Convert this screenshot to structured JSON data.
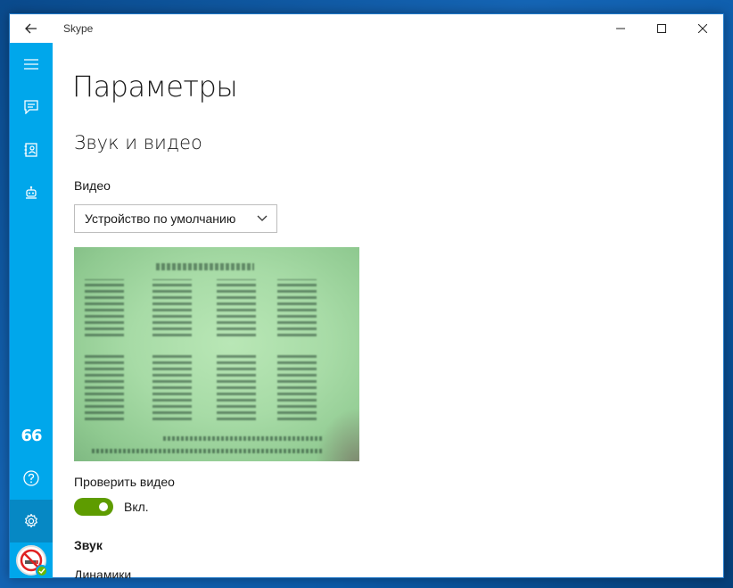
{
  "window": {
    "app_title": "Skype"
  },
  "sidebar": {
    "items": [
      {
        "name": "menu",
        "icon": "hamburger-icon"
      },
      {
        "name": "chats",
        "icon": "chat-icon"
      },
      {
        "name": "contacts",
        "icon": "contacts-icon"
      },
      {
        "name": "bots",
        "icon": "bot-icon"
      },
      {
        "name": "quotes",
        "icon": "quote-icon",
        "glyph": "66"
      },
      {
        "name": "help",
        "icon": "help-icon"
      },
      {
        "name": "settings",
        "icon": "gear-icon",
        "active": true
      },
      {
        "name": "profile",
        "icon": "avatar"
      }
    ],
    "accent_color": "#00a7eb",
    "active_color": "#0688c4"
  },
  "settings": {
    "page_title": "Параметры",
    "section_title": "Звук и видео",
    "video_label": "Видео",
    "video_device": "Устройство по умолчанию",
    "test_video_label": "Проверить видео",
    "test_video_toggle": {
      "on": true,
      "text": "Вкл."
    },
    "sound_section": "Звук",
    "speakers_label": "Динамики"
  },
  "colors": {
    "toggle_on": "#5e9c00",
    "presence_online": "#6bb700"
  }
}
